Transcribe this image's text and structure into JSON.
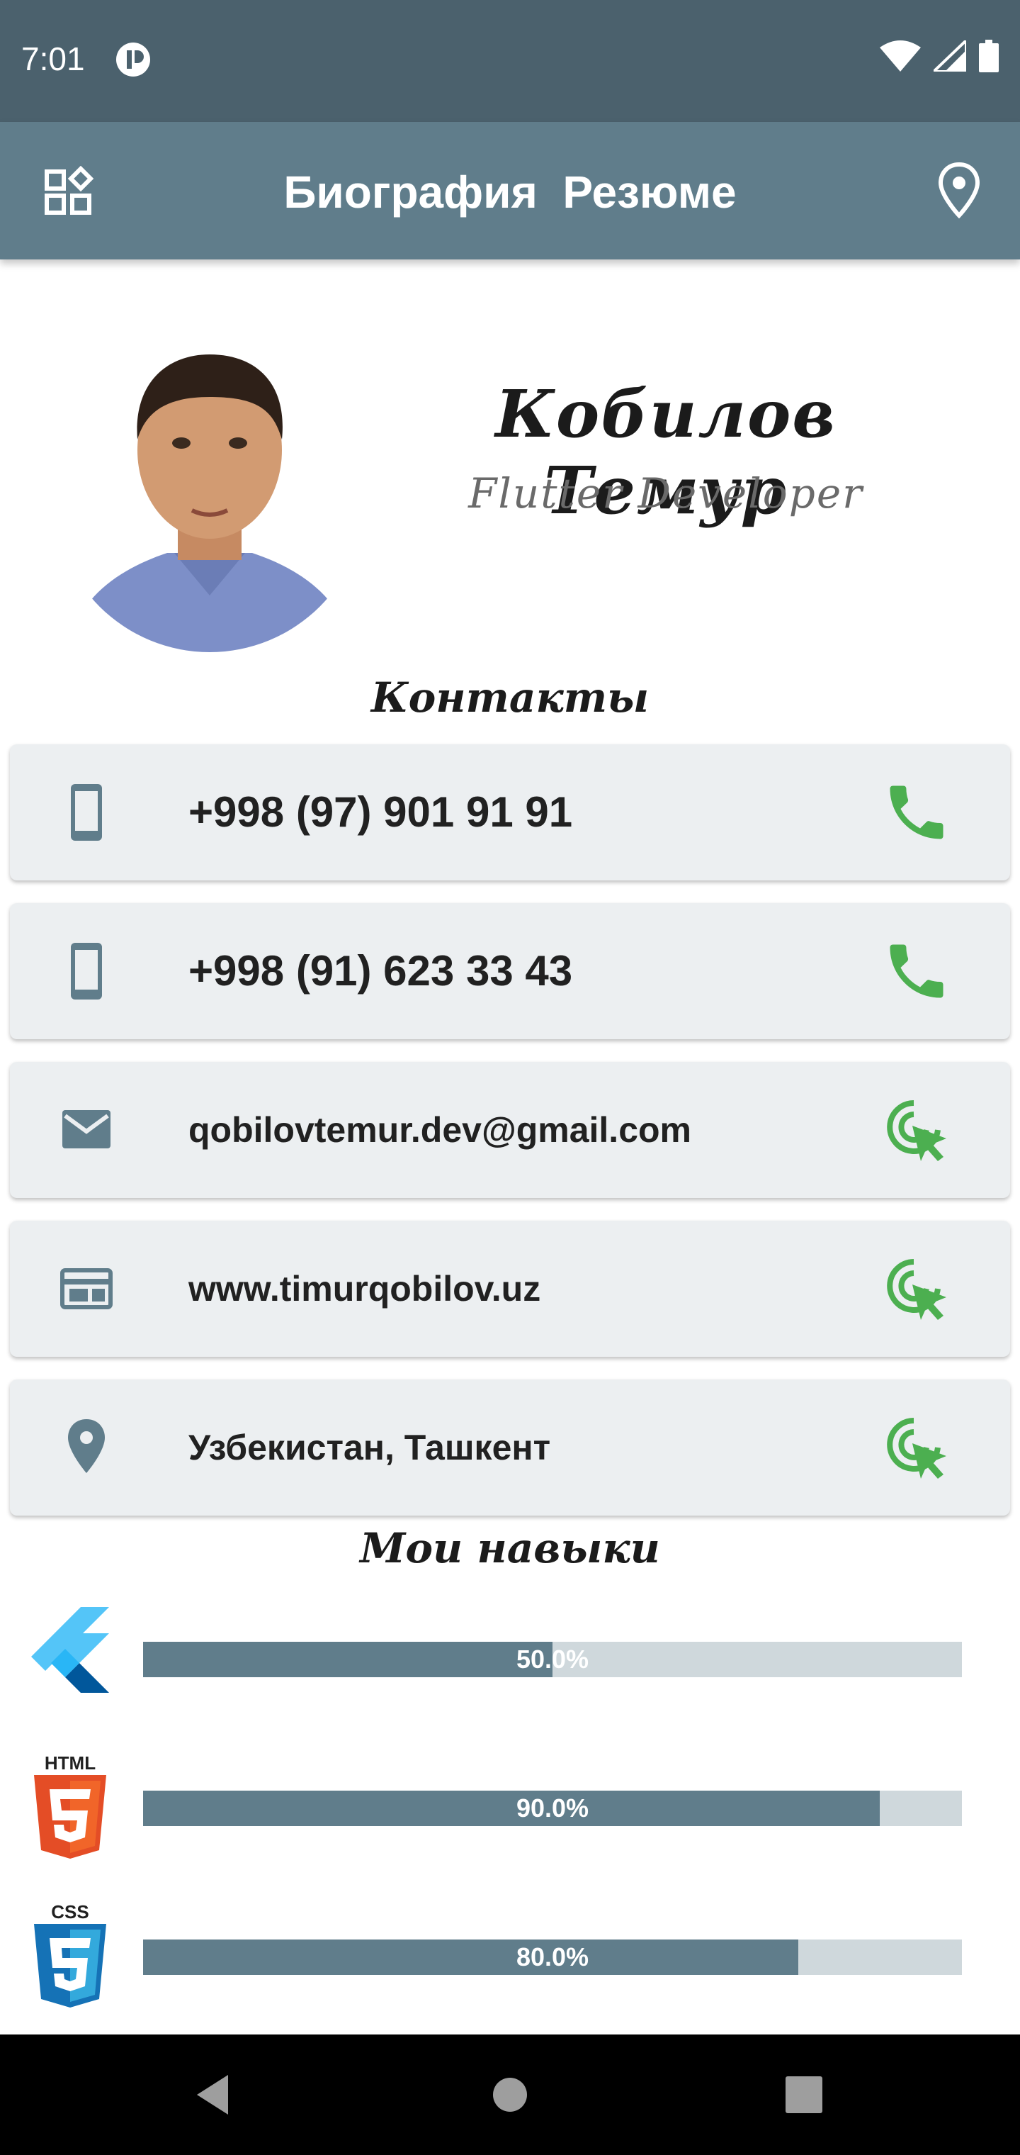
{
  "status_bar": {
    "time": "7:01",
    "icons": [
      "app-notification-icon",
      "wifi-icon",
      "signal-icon",
      "battery-icon"
    ]
  },
  "app_bar": {
    "title": "Биография  Резюме",
    "left_icon": "widgets-icon",
    "right_icon": "location-pin-icon",
    "color": "#607d8b"
  },
  "profile": {
    "name": "Кобилов  Темур",
    "role": "Flutter  Developer"
  },
  "contacts": {
    "title": "Контакты",
    "items": [
      {
        "icon": "smartphone-icon",
        "text": "+998 (97) 901 91 91",
        "action_icon": "phone-call-icon"
      },
      {
        "icon": "smartphone-icon",
        "text": "+998 (91) 623 33 43",
        "action_icon": "phone-call-icon"
      },
      {
        "icon": "email-icon",
        "text": "qobilovtemur.dev@gmail.com",
        "action_icon": "ads-click-icon"
      },
      {
        "icon": "web-icon",
        "text": "www.timurqobilov.uz",
        "action_icon": "ads-click-icon"
      },
      {
        "icon": "location-icon",
        "text": "Узбекистан, Ташкент",
        "action_icon": "ads-click-icon"
      }
    ]
  },
  "skills": {
    "title": "Мои  навыки",
    "items": [
      {
        "name": "flutter-logo",
        "label": "50.0%",
        "value": 0.5
      },
      {
        "name": "html5-logo",
        "label": "HTML",
        "percent": "90.0%",
        "value": 0.9
      },
      {
        "name": "css3-logo",
        "label": "CSS",
        "percent": "80.0%",
        "value": 0.8
      }
    ]
  },
  "colors": {
    "status_bar": "#4b616d",
    "accent": "#607d8b",
    "card_bg": "#eceff1",
    "action_green": "#4caf50",
    "bar_track": "#cfd8dc"
  }
}
